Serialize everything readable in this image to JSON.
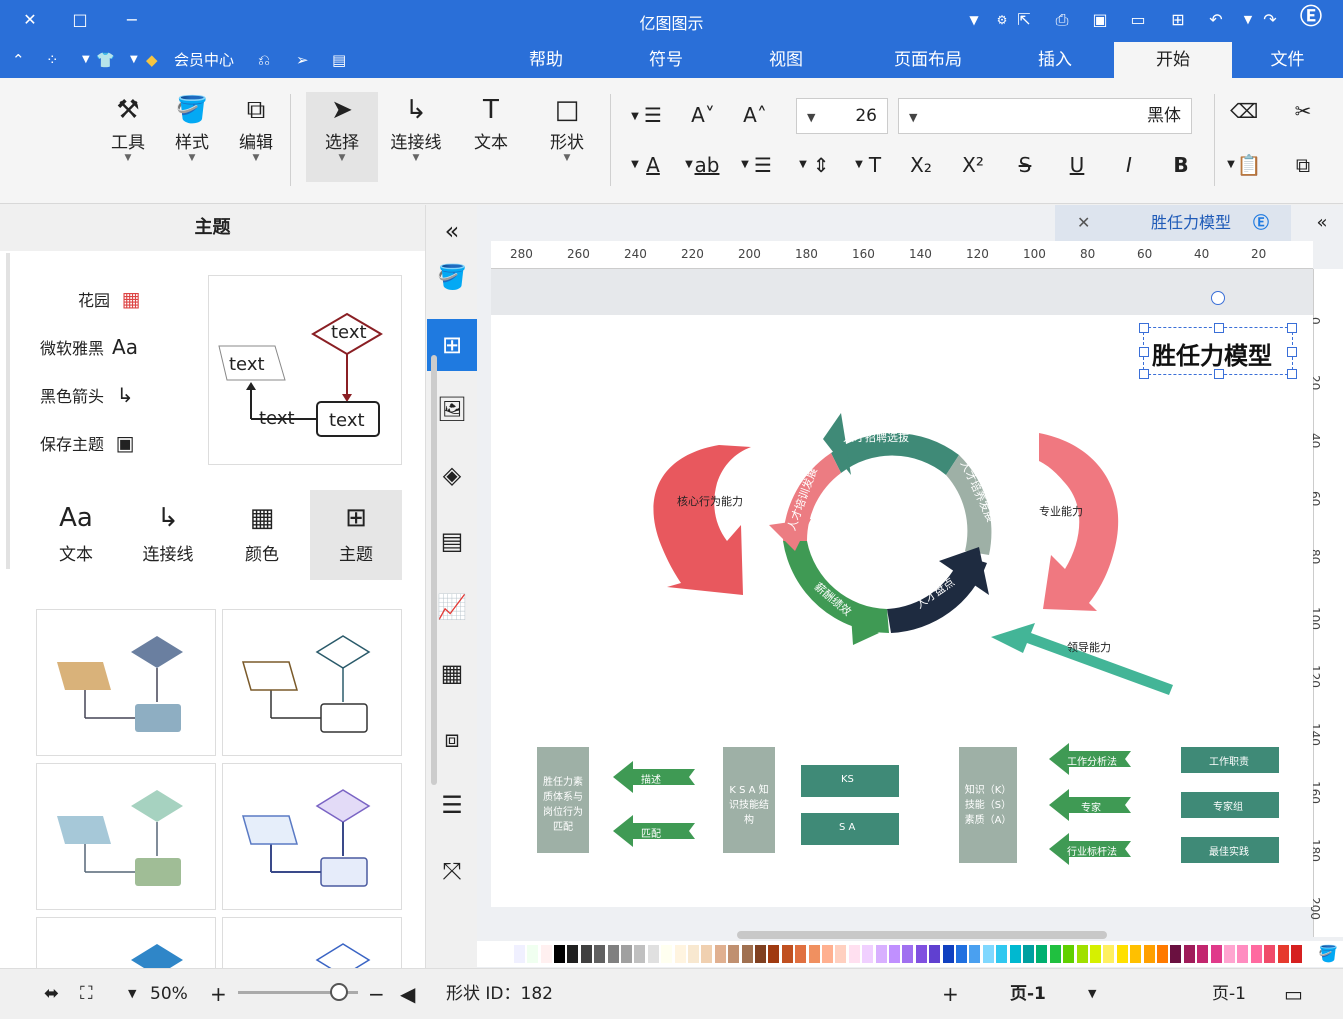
{
  "app": {
    "title": "亿图图示"
  },
  "window": {
    "minimize": "−",
    "maximize": "□",
    "close": "✕"
  },
  "menu": {
    "tabs": [
      {
        "label": "文件"
      },
      {
        "label": "开始"
      },
      {
        "label": "插入"
      },
      {
        "label": "页面布局"
      },
      {
        "label": "视图"
      },
      {
        "label": "符号"
      },
      {
        "label": "帮助"
      }
    ],
    "member_label": "会员中心"
  },
  "ribbon": {
    "tools": {
      "select": "选择",
      "connector": "连接线",
      "text": "文本",
      "shape": "形状",
      "style": "样式",
      "edit": "编辑",
      "tool": "工具"
    },
    "font_family": "黑体",
    "font_size": "26"
  },
  "left_panel": {
    "title": "主题",
    "theme_items": [
      {
        "label": "花园",
        "icon": "palette-icon"
      },
      {
        "label": "微软雅黑",
        "icon": "Aa"
      },
      {
        "label": "黑色箭头",
        "icon": "connector-icon"
      },
      {
        "label": "保存主题",
        "icon": "save-icon"
      }
    ],
    "preview_texts": [
      "text",
      "text",
      "text",
      "text"
    ],
    "tabs": [
      {
        "label": "主题",
        "icon": "theme-grid-icon"
      },
      {
        "label": "颜色",
        "icon": "color-grid-icon"
      },
      {
        "label": "连接线",
        "icon": "connector-icon"
      },
      {
        "label": "文本",
        "icon": "Aa"
      }
    ]
  },
  "document": {
    "tab_title": "胜任力模型",
    "diagram_title": "胜任力模型",
    "ruler_h": [
      "20",
      "40",
      "60",
      "80",
      "100",
      "120",
      "140",
      "160",
      "180",
      "200",
      "220",
      "240",
      "260",
      "280"
    ],
    "ruler_v": [
      "0",
      "20",
      "40",
      "60",
      "80",
      "100",
      "120",
      "140",
      "160",
      "180",
      "200"
    ],
    "cycle_labels": [
      "人才招聘选拔",
      "人才培养发展",
      "薪酬绩效",
      "人才盘点",
      "人才培训发展"
    ],
    "side_labels": [
      "核心行为能力",
      "专业能力",
      "领导能力"
    ],
    "left_row": {
      "box": "胜任力素质体系与岗位行为匹配",
      "arrow_top": "描述",
      "arrow_bottom": "匹配",
      "ksa_box": "K S A 知识技能结构",
      "rect_top": "KS",
      "rect_bottom": "S A"
    },
    "right_row": {
      "box": "知识（K）技能（S）素质（A）",
      "arrows": [
        "工作分析法",
        "专家",
        "行业标杆法"
      ],
      "rects": [
        "工作职责",
        "专家组",
        "最佳实践"
      ]
    }
  },
  "status": {
    "page_label": "页-1",
    "page_tab": "页-1",
    "add_page": "+",
    "shape_id": "形状 ID：182",
    "zoom": "50%"
  },
  "colors": {
    "accent": "#2a6fd8",
    "active_strip": "#1f7ae0",
    "teal": "#3f8a77",
    "red": "#e8585e",
    "green": "#3f9a54",
    "navy": "#1e2b40",
    "sage": "#9eb0a6"
  }
}
